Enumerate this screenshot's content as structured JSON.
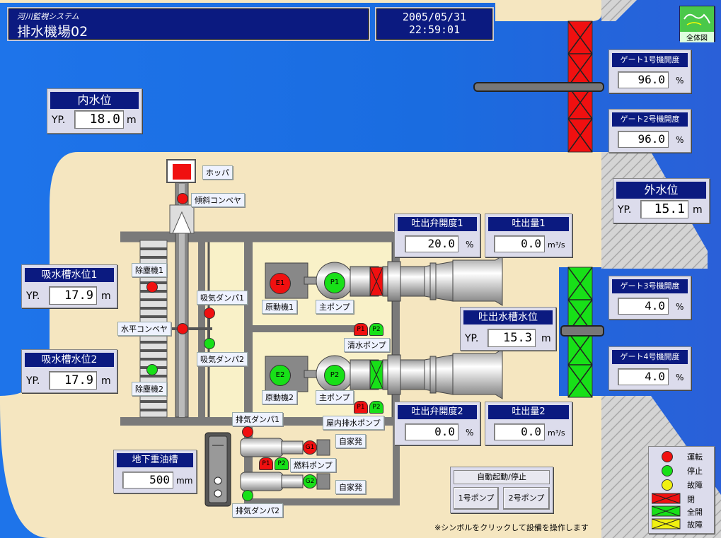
{
  "header": {
    "system_name": "河川監視システム",
    "station_name": "排水機場02"
  },
  "datetime": {
    "date": "2005/05/31",
    "time": "22:59:01"
  },
  "overview_button": {
    "label": "全体図"
  },
  "inner_level": {
    "title": "内水位",
    "prefix": "YP.",
    "value": "18.0",
    "unit": "m"
  },
  "outer_level": {
    "title": "外水位",
    "prefix": "YP.",
    "value": "15.1",
    "unit": "m"
  },
  "gates": [
    {
      "title": "ゲート1号機開度",
      "value": "96.0",
      "unit": "%"
    },
    {
      "title": "ゲート2号機開度",
      "value": "96.0",
      "unit": "%"
    },
    {
      "title": "ゲート3号機開度",
      "value": "4.0",
      "unit": "%"
    },
    {
      "title": "ゲート4号機開度",
      "value": "4.0",
      "unit": "%"
    }
  ],
  "intake_levels": [
    {
      "title": "吸水槽水位1",
      "prefix": "YP.",
      "value": "17.9",
      "unit": "m"
    },
    {
      "title": "吸水槽水位2",
      "prefix": "YP.",
      "value": "17.9",
      "unit": "m"
    }
  ],
  "discharge_valves": [
    {
      "title": "吐出弁開度1",
      "value": "20.0",
      "unit": "%"
    },
    {
      "title": "吐出弁開度2",
      "value": "0.0",
      "unit": "%"
    }
  ],
  "discharge_flows": [
    {
      "title": "吐出量1",
      "value": "0.0",
      "unit": "m³/s"
    },
    {
      "title": "吐出量2",
      "value": "0.0",
      "unit": "m³/s"
    }
  ],
  "discharge_tank": {
    "title": "吐出水槽水位",
    "prefix": "YP.",
    "value": "15.3",
    "unit": "m"
  },
  "fuel_tank": {
    "title": "地下重油槽",
    "value": "500",
    "unit": "mm"
  },
  "labels": {
    "hopper": "ホッパ",
    "incline_conveyor": "傾斜コンベヤ",
    "screen1": "除塵機1",
    "screen2": "除塵機2",
    "horiz_conveyor": "水平コンベヤ",
    "intake_damper1": "吸気ダンパ1",
    "intake_damper2": "吸気ダンパ2",
    "engine1": "原動機1",
    "engine2": "原動機2",
    "main_pump1": "主ポンプ",
    "main_pump2": "主ポンプ",
    "clean_pump": "清水ポンプ",
    "drain_pump": "屋内排水ポンプ",
    "exhaust_damper1": "排気ダンパ1",
    "exhaust_damper2": "排気ダンパ2",
    "generator1": "自家発",
    "generator2": "自家発",
    "fuel_pump": "燃料ポンプ",
    "e1": "E1",
    "e2": "E2",
    "p1": "P1",
    "p2": "P2",
    "g1": "G1",
    "g2": "G2"
  },
  "auto_control": {
    "title": "自動起動/停止",
    "pump1": "1号ポンプ",
    "pump2": "2号ポンプ"
  },
  "legend": [
    {
      "label": "運転",
      "kind": "red-dot"
    },
    {
      "label": "停止",
      "kind": "green-dot"
    },
    {
      "label": "故障",
      "kind": "yellow-dot"
    },
    {
      "label": "閉",
      "kind": "red-bar"
    },
    {
      "label": "全開",
      "kind": "green-bar"
    },
    {
      "label": "故障",
      "kind": "yellow-bar"
    }
  ],
  "note": "※シンボルをクリックして設備を操作します",
  "colors": {
    "water": "#1a6fe6",
    "land": "#f5e6c0",
    "bank": "#c0c0c0",
    "header": "#0b1a80",
    "run": "#f01010",
    "stop": "#18e018",
    "fault": "#f0f010"
  }
}
